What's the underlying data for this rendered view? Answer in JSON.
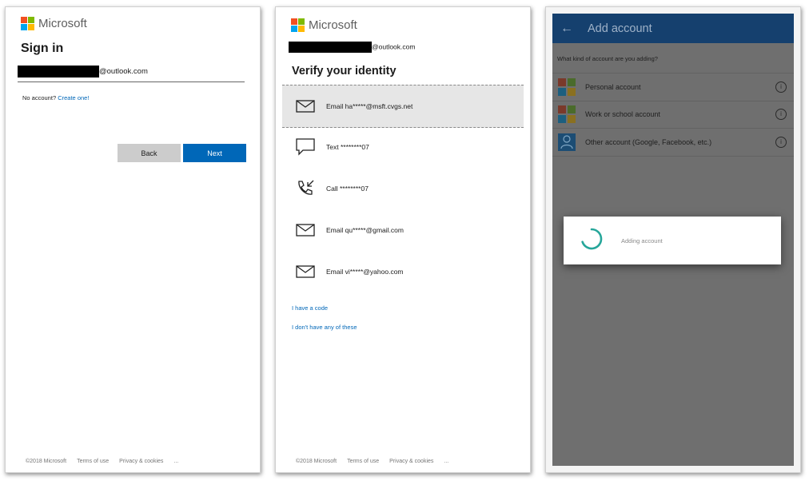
{
  "brand": {
    "name": "Microsoft",
    "colors": {
      "red": "#f25022",
      "green": "#7fba00",
      "blue": "#00a4ef",
      "yellow": "#ffb900"
    }
  },
  "signin": {
    "title": "Sign in",
    "email_domain": "@outlook.com",
    "no_account_text": "No account?",
    "create_link": "Create one!",
    "back_label": "Back",
    "next_label": "Next",
    "accent_color": "#0067b8"
  },
  "verify": {
    "email_domain": "@outlook.com",
    "title": "Verify your identity",
    "options": [
      {
        "icon": "mail-icon",
        "label": "Email ha*****@msft.cvgs.net",
        "selected": true
      },
      {
        "icon": "chat-icon",
        "label": "Text ********07",
        "selected": false
      },
      {
        "icon": "phone-icon",
        "label": "Call ********07",
        "selected": false
      },
      {
        "icon": "mail-icon",
        "label": "Email qu*****@gmail.com",
        "selected": false
      },
      {
        "icon": "mail-icon",
        "label": "Email vi*****@yahoo.com",
        "selected": false
      }
    ],
    "have_code_link": "I have a code",
    "none_link": "I don't have any of these"
  },
  "footer": {
    "copyright": "©2018 Microsoft",
    "terms": "Terms of use",
    "privacy": "Privacy & cookies",
    "more": "..."
  },
  "add_account": {
    "back_icon": "arrow-left-icon",
    "title": "Add account",
    "question": "What kind of account are you adding?",
    "accounts": [
      {
        "icon": "microsoft-logo-icon",
        "label": "Personal account"
      },
      {
        "icon": "microsoft-logo-icon",
        "label": "Work or school account"
      },
      {
        "icon": "person-icon",
        "label": "Other account (Google, Facebook, etc.)"
      }
    ],
    "dialog_text": "Adding account",
    "appbar_color": "#15406e",
    "spinner_color": "#26a69a"
  }
}
